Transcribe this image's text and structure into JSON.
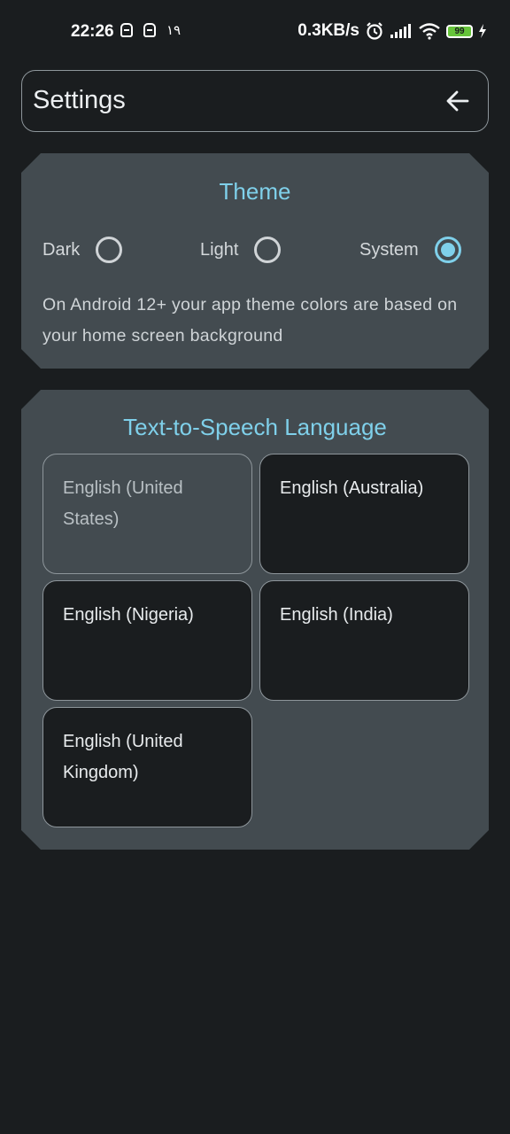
{
  "status_bar": {
    "time": "22:26",
    "extra_text": "۱۹",
    "net_speed": "0.3KB/s",
    "battery": "99"
  },
  "header": {
    "title": "Settings",
    "back_icon": "arrow-left-icon"
  },
  "theme": {
    "title": "Theme",
    "options": [
      {
        "label": "Dark",
        "selected": false
      },
      {
        "label": "Light",
        "selected": false
      },
      {
        "label": "System",
        "selected": true
      }
    ],
    "description": "On Android 12+ your app theme colors are based on your home screen background"
  },
  "tts": {
    "title": "Text-to-Speech Language",
    "languages": [
      {
        "label": "English (United States)",
        "selected": true
      },
      {
        "label": "English (Australia)",
        "selected": false
      },
      {
        "label": "English (Nigeria)",
        "selected": false
      },
      {
        "label": "English (India)",
        "selected": false
      },
      {
        "label": "English (United Kingdom)",
        "selected": false
      }
    ]
  },
  "colors": {
    "accent": "#7fd0ea",
    "background": "#1a1d1f",
    "card": "#434b50",
    "border": "#8e969b"
  }
}
